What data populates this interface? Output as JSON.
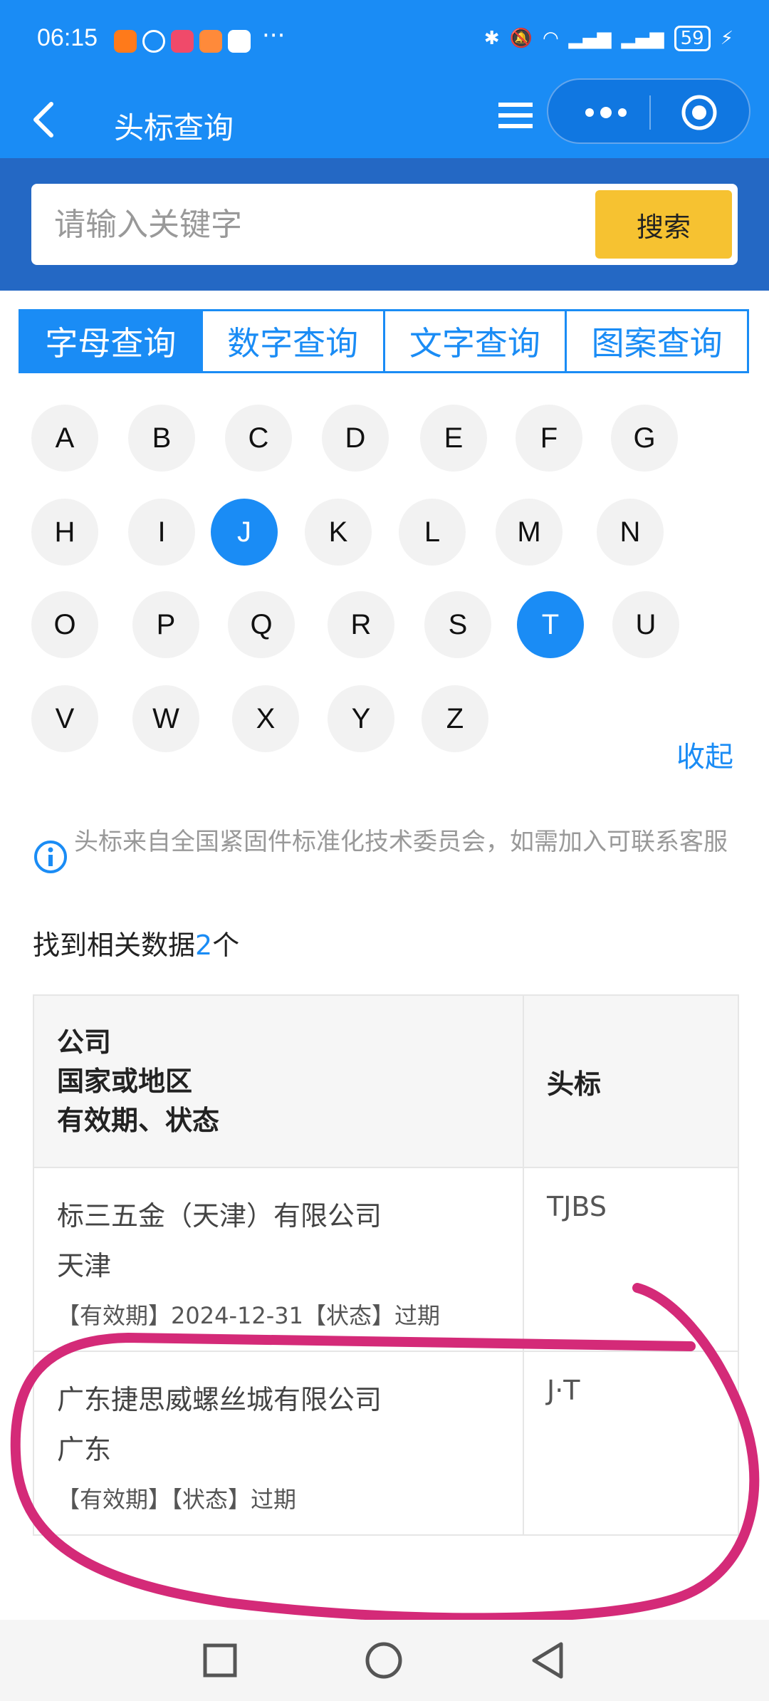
{
  "status_bar": {
    "time": "06:15",
    "more": "···",
    "battery": "59"
  },
  "nav": {
    "title": "头标查询"
  },
  "search": {
    "placeholder": "请输入关键字",
    "button": "搜索"
  },
  "tabs": [
    {
      "label": "字母查询",
      "active": true
    },
    {
      "label": "数字查询",
      "active": false
    },
    {
      "label": "文字查询",
      "active": false
    },
    {
      "label": "图案查询",
      "active": false
    }
  ],
  "letters": [
    "A",
    "B",
    "C",
    "D",
    "E",
    "F",
    "G",
    "H",
    "I",
    "J",
    "K",
    "L",
    "M",
    "N",
    "O",
    "P",
    "Q",
    "R",
    "S",
    "T",
    "U",
    "V",
    "W",
    "X",
    "Y",
    "Z"
  ],
  "selected_letters": [
    "J",
    "T"
  ],
  "collapse_label": "收起",
  "notice": "头标来自全国紧固件标准化技术委员会，如需加入可联系客服",
  "found": {
    "prefix": "找到相关数据",
    "count": "2",
    "suffix": "个"
  },
  "table": {
    "header_left": [
      "公司",
      "国家或地区",
      "有效期、状态"
    ],
    "header_right": "头标",
    "rows": [
      {
        "company": "标三五金（天津）有限公司",
        "region": "天津",
        "validity": "【有效期】2024-12-31【状态】过期",
        "mark": "TJBS"
      },
      {
        "company": "广东捷思威螺丝城有限公司",
        "region": "广东",
        "validity": "【有效期】【状态】过期",
        "mark": "J·T"
      }
    ]
  },
  "colors": {
    "primary": "#1a8cf5",
    "search_band": "#2468c4",
    "search_button": "#f6c231",
    "annotation": "#d42a78"
  },
  "icons": [
    "back-arrow-icon",
    "menu-icon",
    "more-dots-icon",
    "target-icon",
    "info-icon",
    "square-nav-icon",
    "circle-nav-icon",
    "triangle-back-nav-icon"
  ]
}
